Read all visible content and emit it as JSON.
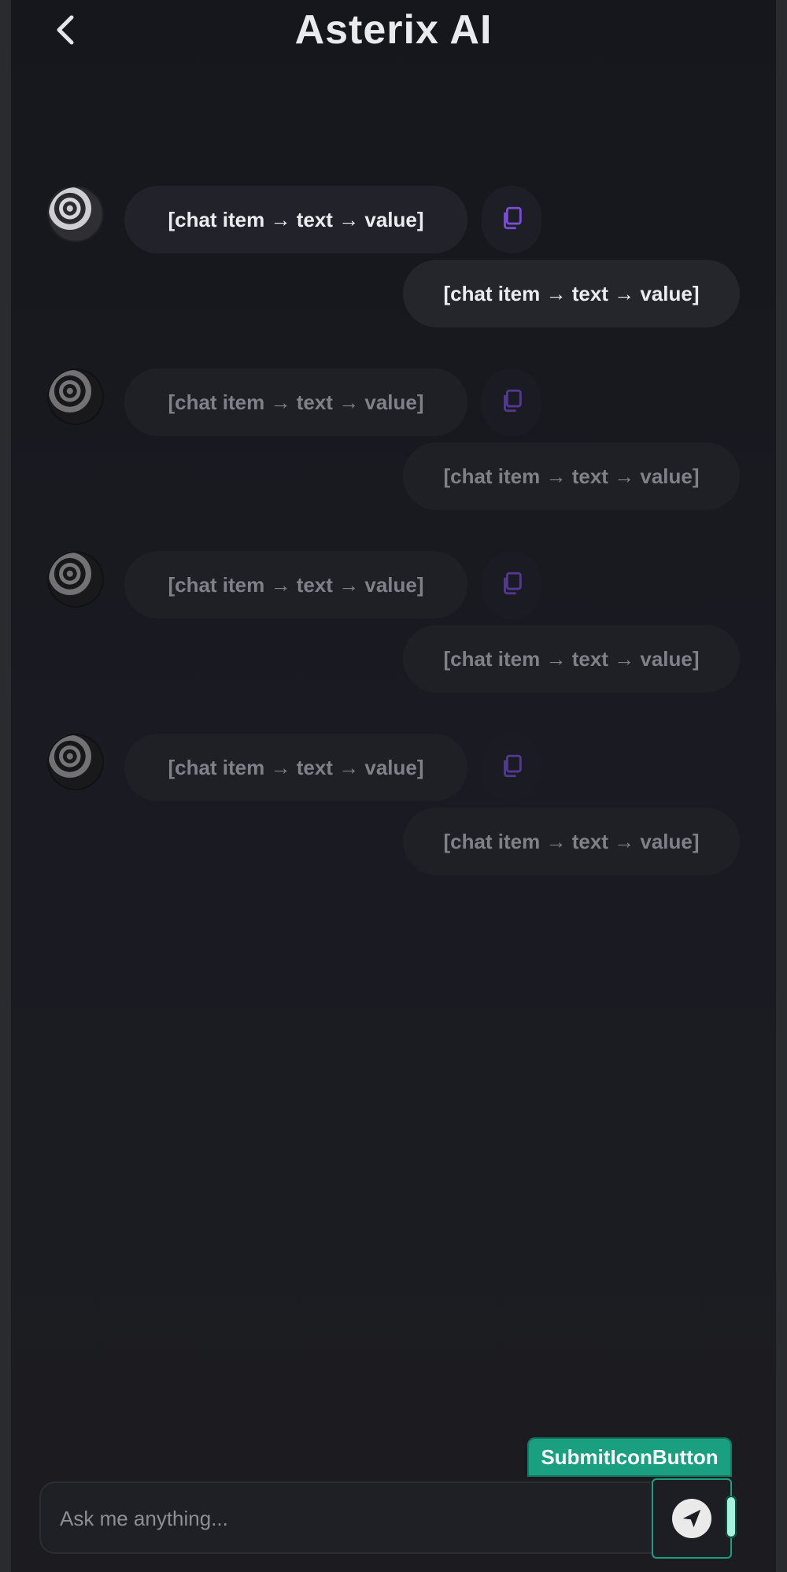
{
  "app": {
    "title": "Asterix AI"
  },
  "icons": {
    "back": "chevron-left-icon",
    "copy": "copy-icon",
    "submit": "send-icon"
  },
  "colors": {
    "accent_purple": "#7a4fd6",
    "submit_accent": "#1aa081"
  },
  "chat": {
    "items": [
      {
        "bot": "[chat item → text → value]",
        "user": "[chat item → text → value]",
        "faded": false
      },
      {
        "bot": "[chat item → text → value]",
        "user": "[chat item → text → value]",
        "faded": true
      },
      {
        "bot": "[chat item → text → value]",
        "user": "[chat item → text → value]",
        "faded": true
      },
      {
        "bot": "[chat item → text → value]",
        "user": "[chat item → text → value]",
        "faded": true
      }
    ]
  },
  "input": {
    "placeholder": "Ask me anything..."
  },
  "submit": {
    "label": "SubmitIconButton"
  }
}
